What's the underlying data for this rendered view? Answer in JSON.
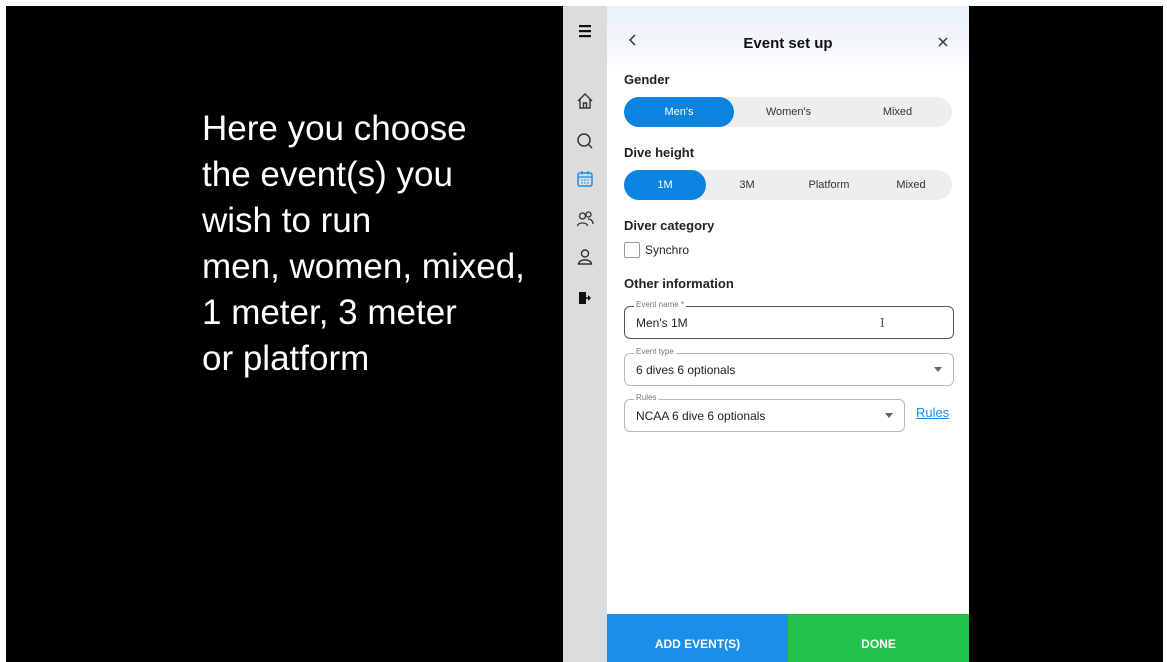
{
  "caption": {
    "lines": [
      "Here you choose",
      "the event(s) you",
      "wish to run",
      "men, women, mixed,",
      "1 meter, 3 meter",
      "or platform"
    ]
  },
  "sidebar": {
    "icons": [
      "menu-icon",
      "home-icon",
      "search-icon",
      "calendar-icon",
      "users-icon",
      "user-icon",
      "logout-icon"
    ],
    "active": "calendar-icon",
    "accent": "#1a8fe8"
  },
  "panel": {
    "title": "Event set up",
    "gender": {
      "label": "Gender",
      "options": [
        "Men's",
        "Women's",
        "Mixed"
      ],
      "selected": "Men's"
    },
    "dive_height": {
      "label": "Dive height",
      "options": [
        "1M",
        "3M",
        "Platform",
        "Mixed"
      ],
      "selected": "1M"
    },
    "diver_category": {
      "label": "Diver category",
      "synchro_label": "Synchro",
      "synchro_checked": false
    },
    "other_info": {
      "label": "Other information",
      "event_name": {
        "legend": "Event name *",
        "value": "Men's 1M"
      },
      "event_type": {
        "legend": "Event type",
        "value": "6 dives 6 optionals"
      },
      "rules": {
        "legend": "Rules",
        "value": "NCAA 6 dive 6 optionals",
        "link": "Rules"
      }
    },
    "buttons": {
      "add": "ADD EVENT(S)",
      "done": "DONE"
    }
  },
  "colors": {
    "primary": "#0a84e0",
    "success": "#22c24a"
  }
}
